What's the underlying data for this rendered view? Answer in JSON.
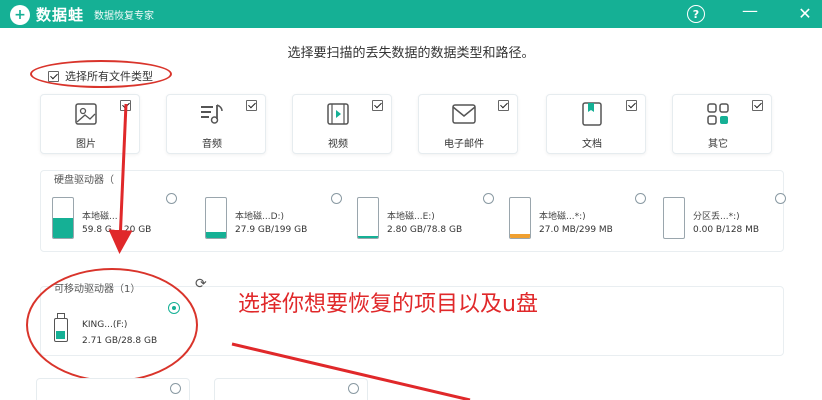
{
  "app": {
    "name": "数据蛙",
    "subtitle": "数据恢复专家",
    "logo_glyph": "+",
    "help_glyph": "?",
    "minimize_glyph": "—",
    "close_glyph": "✕"
  },
  "page_title": "选择要扫描的丢失数据的数据类型和路径。",
  "select_all": {
    "label": "选择所有文件类型",
    "checked": true
  },
  "file_types": [
    {
      "label": "图片",
      "icon": "image-icon",
      "checked": true
    },
    {
      "label": "音频",
      "icon": "music-icon",
      "checked": true
    },
    {
      "label": "视频",
      "icon": "video-icon",
      "checked": true
    },
    {
      "label": "电子邮件",
      "icon": "email-icon",
      "checked": true
    },
    {
      "label": "文档",
      "icon": "document-icon",
      "checked": true
    },
    {
      "label": "其它",
      "icon": "other-icon",
      "checked": true
    }
  ],
  "hard_drives": {
    "label": "硬盘驱动器（",
    "items": [
      {
        "name": "本地磁...",
        "size": "59.8 G",
        "size_tail": "20 GB",
        "fill_pct": 50,
        "fill_color": "#15b095"
      },
      {
        "name": "本地磁...D:)",
        "size": "27.9 GB/199 GB",
        "fill_pct": 14,
        "fill_color": "#15b095"
      },
      {
        "name": "本地磁...E:)",
        "size": "2.80 GB/78.8 GB",
        "fill_pct": 4,
        "fill_color": "#15b095"
      },
      {
        "name": "本地磁...*:)",
        "size": "27.0 MB/299 MB",
        "fill_pct": 9,
        "fill_color": "#f0a030"
      },
      {
        "name": "分区丢...*:)",
        "size": "0.00 B/128 MB",
        "fill_pct": 0,
        "fill_color": "#15b095"
      }
    ]
  },
  "removable": {
    "label": "可移动驱动器（1）",
    "refresh_glyph": "⟳",
    "item": {
      "name": "KING...(F:)",
      "size": "2.71 GB/28.8 GB",
      "selected": true
    }
  },
  "annotation": "选择你想要恢复的项目以及u盘",
  "colors": {
    "brand": "#15b095",
    "annotation_red": "#e0282a"
  }
}
